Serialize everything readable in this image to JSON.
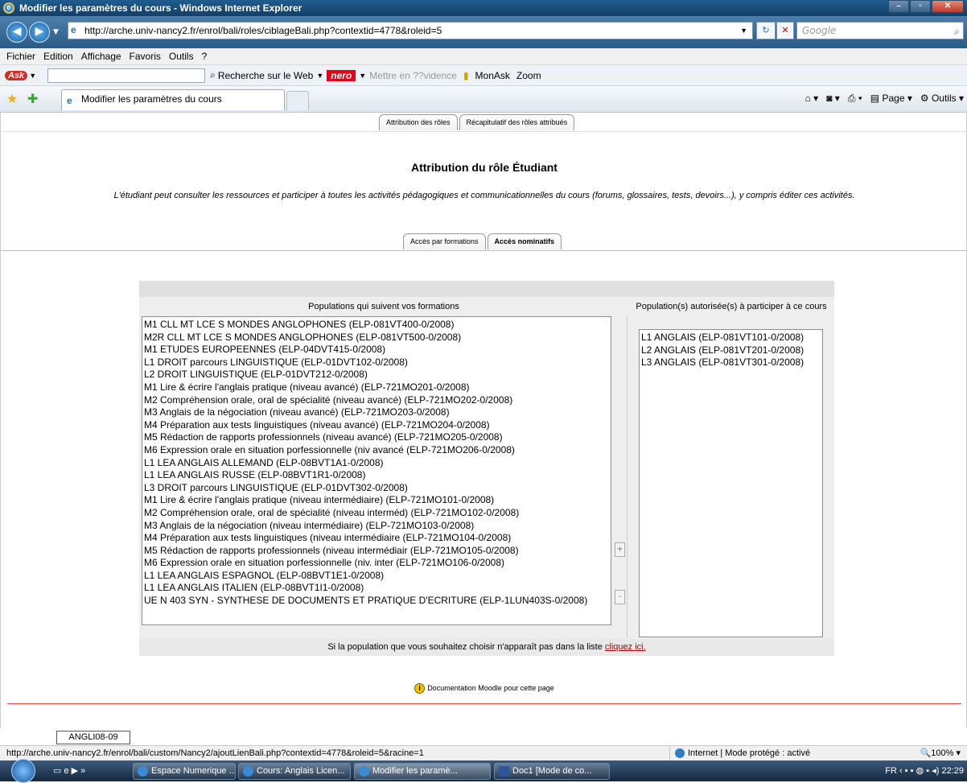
{
  "window": {
    "title": "Modifier les paramètres du cours - Windows Internet Explorer"
  },
  "address": {
    "url": "http://arche.univ-nancy2.fr/enrol/bali/roles/ciblageBali.php?contextid=4778&roleid=5",
    "search_placeholder": "Google"
  },
  "menu": [
    "Fichier",
    "Edition",
    "Affichage",
    "Favoris",
    "Outils",
    "?"
  ],
  "asktoolbar": {
    "ask": "Ask",
    "search_web": "Recherche sur le Web",
    "nero": "nero",
    "highlight": "Mettre en ??vidence",
    "monask": "MonAsk",
    "zoom": "Zoom"
  },
  "tab": {
    "title": "Modifier les paramètres du cours"
  },
  "command_bar": {
    "page": "Page",
    "tools": "Outils"
  },
  "page": {
    "tabs_top": [
      "Attribution des rôles",
      "Récapitulatif des rôles attribués"
    ],
    "heading": "Attribution du rôle Étudiant",
    "description": "L'étudiant peut consulter les ressources et participer à toutes les activités pédagogiques et communicationnelles du cours (forums, glossaires, tests, devoirs...), y compris éditer ces activités.",
    "tabs_sub": [
      "Accès par formations",
      "Accès nominatifs"
    ],
    "left_header": "Populations qui suivent vos formations",
    "right_header": "Population(s) autorisée(s) à participer à ce cours",
    "left_items": [
      "M1 CLL MT LCE S MONDES ANGLOPHONES (ELP-081VT400-0/2008)",
      "M2R CLL MT LCE S MONDES ANGLOPHONES (ELP-081VT500-0/2008)",
      "M1 ETUDES EUROPEENNES (ELP-04DVT415-0/2008)",
      "L1 DROIT parcours LINGUISTIQUE (ELP-01DVT102-0/2008)",
      "L2 DROIT LINGUISTIQUE (ELP-01DVT212-0/2008)",
      "M1 Lire & écrire l'anglais pratique (niveau avancé) (ELP-721MO201-0/2008)",
      "M2 Compréhension orale, oral de spécialité (niveau avancé) (ELP-721MO202-0/2008)",
      "M3 Anglais de la négociation (niveau avancé) (ELP-721MO203-0/2008)",
      "M4 Préparation aux tests linguistiques (niveau avancé) (ELP-721MO204-0/2008)",
      "M5 Rédaction de rapports professionnels (niveau avancé) (ELP-721MO205-0/2008)",
      "M6 Expression orale en situation porfessionnelle (niv avancé (ELP-721MO206-0/2008)",
      "L1 LEA ANGLAIS ALLEMAND (ELP-08BVT1A1-0/2008)",
      "L1 LEA ANGLAIS RUSSE (ELP-08BVT1R1-0/2008)",
      "L3 DROIT parcours LINGUISTIQUE (ELP-01DVT302-0/2008)",
      "M1 Lire & écrire l'anglais pratique (niveau intermédiaire) (ELP-721MO101-0/2008)",
      "M2 Compréhension orale, oral de spécialité (niveau interméd) (ELP-721MO102-0/2008)",
      "M3 Anglais de la négociation (niveau intermédiaire) (ELP-721MO103-0/2008)",
      "M4 Préparation aux tests linguistiques (niveau intermédiaire (ELP-721MO104-0/2008)",
      "M5 Rédaction de rapports professionnels (niveau intermédiair (ELP-721MO105-0/2008)",
      "M6 Expression orale en situation porfessionnelle (niv. inter (ELP-721MO106-0/2008)",
      "L1 LEA ANGLAIS ESPAGNOL (ELP-08BVT1E1-0/2008)",
      "L1 LEA ANGLAIS ITALIEN (ELP-08BVT1I1-0/2008)",
      "UE N 403 SYN - SYNTHESE DE DOCUMENTS ET PRATIQUE D'ECRITURE (ELP-1LUN403S-0/2008)"
    ],
    "right_items": [
      "L1 ANGLAIS (ELP-081VT101-0/2008)",
      "L2 ANGLAIS (ELP-081VT201-0/2008)",
      "L3 ANGLAIS (ELP-081VT301-0/2008)"
    ],
    "add_label": "+",
    "remove_label": "-",
    "footnote_text": "Si la population que vous souhaitez choisir n'apparaît pas dans la liste ",
    "footnote_link": "cliquez ici.",
    "doc_link": "Documentation Moodle pour cette page",
    "course_shortname": "ANGLI08-09"
  },
  "status": {
    "url": "http://arche.univ-nancy2.fr/enrol/bali/custom/Nancy2/ajoutLienBali.php?contextid=4778&roleid=5&racine=1",
    "zone": "Internet | Mode protégé : activé",
    "zoom": "100%"
  },
  "taskbar": {
    "tasks": [
      "Espace Numerique ...",
      "Cours: Anglais Licen...",
      "Modifier les paramè...",
      "Doc1 [Mode de co..."
    ],
    "lang": "FR",
    "time": "22:29"
  }
}
